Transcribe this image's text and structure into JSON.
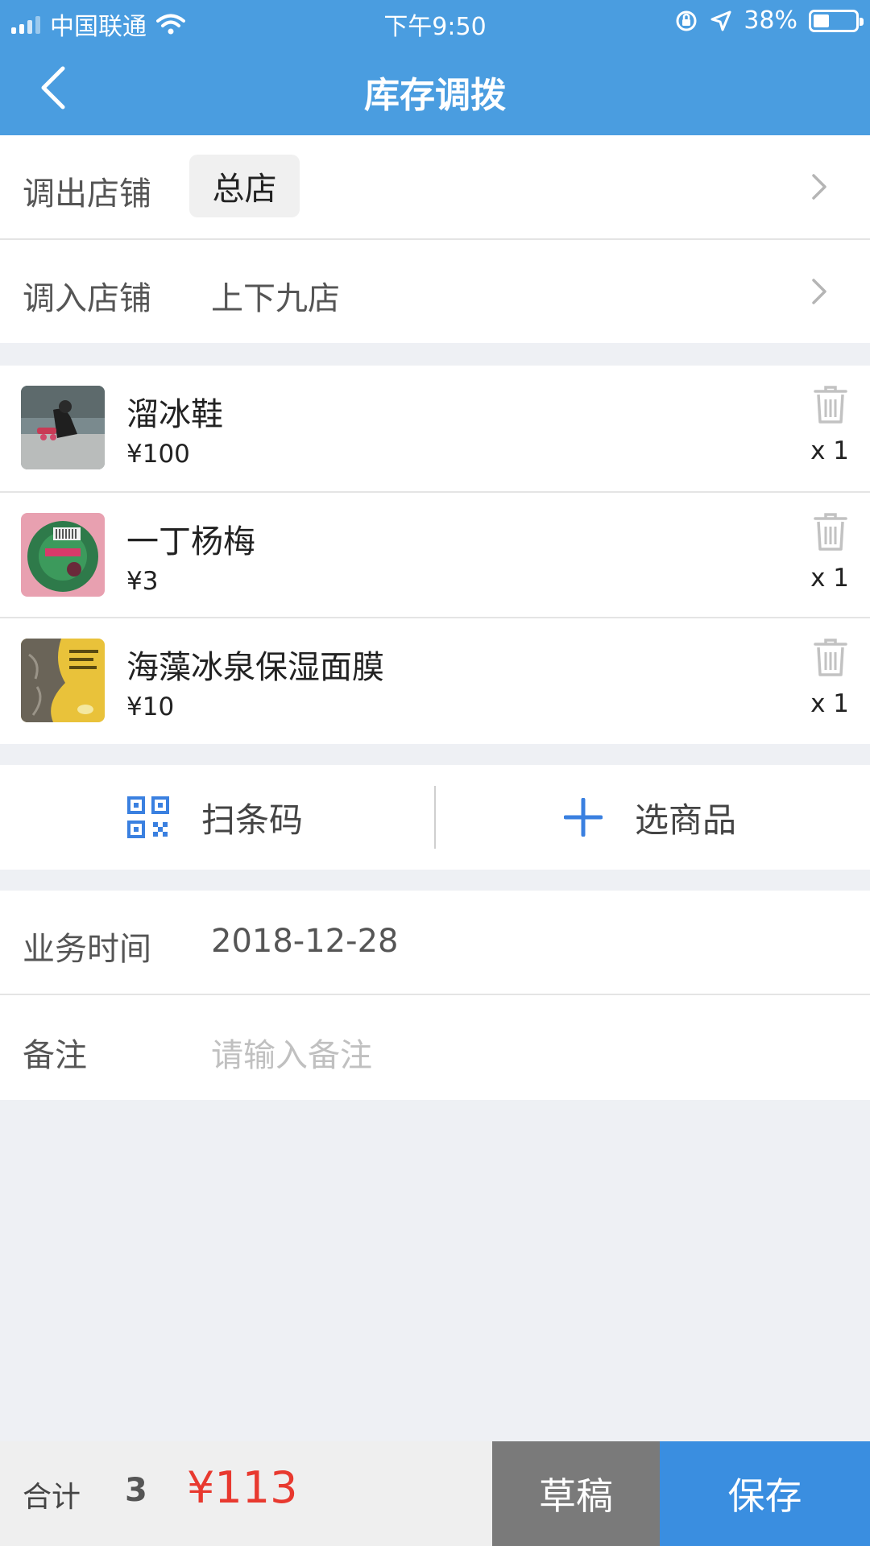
{
  "status_bar": {
    "carrier": "中国联通",
    "time": "下午9:50",
    "battery": "38%",
    "battery_level": 0.38
  },
  "header": {
    "title": "库存调拨",
    "back_icon": "chevron-left-icon"
  },
  "from_store": {
    "label": "调出店铺",
    "value": "总店"
  },
  "to_store": {
    "label": "调入店铺",
    "value": "上下九店"
  },
  "items": [
    {
      "name": "溜冰鞋",
      "price": "¥100",
      "qty": "x 1"
    },
    {
      "name": "一丁杨梅",
      "price": "¥3",
      "qty": "x 1"
    },
    {
      "name": "海藻冰泉保湿面膜",
      "price": "¥10",
      "qty": "x 1"
    }
  ],
  "actions": {
    "scan_label": "扫条码",
    "select_label": "选商品"
  },
  "business_time": {
    "label": "业务时间",
    "value": "2018-12-28"
  },
  "remark": {
    "label": "备注",
    "placeholder": "请输入备注"
  },
  "footer": {
    "total_label": "合计",
    "count": "3",
    "total": "¥113",
    "draft_label": "草稿",
    "save_label": "保存"
  },
  "colors": {
    "header": "#4a9de0",
    "accent": "#3a8ee0",
    "total": "#e8392f"
  }
}
